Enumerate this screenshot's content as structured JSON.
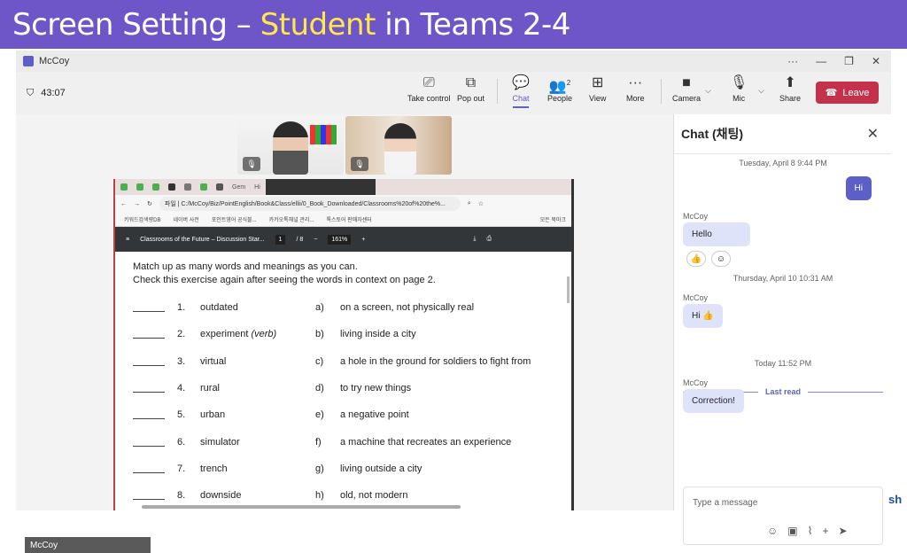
{
  "banner": {
    "prefix": "Screen Setting – ",
    "highlight": "Student",
    "suffix": " in Teams 2-4"
  },
  "window": {
    "title": "McCoy",
    "controls": [
      "···",
      "—",
      "❐",
      "✕"
    ]
  },
  "meeting": {
    "timer": "43:07"
  },
  "toolbar": {
    "take_control": "Take control",
    "pop_out": "Pop out",
    "chat": "Chat",
    "people": "People",
    "people_count": "2",
    "view": "View",
    "more": "More",
    "camera": "Camera",
    "mic": "Mic",
    "share": "Share",
    "leave": "Leave"
  },
  "participants": {
    "name": "McCoy"
  },
  "browser": {
    "tab_label": "Gem",
    "tab2_label": "Hi",
    "url": "C:/McCoy/Biz/PointEnglish/Book&Class/ellii/0_Book_Downloaded/Classrooms%20of%20the%...",
    "url_prefix": "파일",
    "bookmarks": [
      "키워드검색량DB",
      "네이버 사전",
      "포인트영어 공식블...",
      "카카오톡채널 관리...",
      "톡스토어 판매자센터",
      "모든 북마크"
    ]
  },
  "pdf": {
    "title": "Classrooms of the Future – Discussion Star...",
    "page": "1",
    "total_pages": "/ 8",
    "zoom": "161%",
    "intro1": "Match up as many words and meanings as you can.",
    "intro2": "Check this exercise again after seeing the words in context on page 2.",
    "rows": [
      {
        "num": "1.",
        "word": "outdated",
        "note": "",
        "letter": "a)",
        "meaning": "on a screen, not physically real"
      },
      {
        "num": "2.",
        "word": "experiment ",
        "note": "(verb)",
        "letter": "b)",
        "meaning": "living inside a city"
      },
      {
        "num": "3.",
        "word": "virtual",
        "note": "",
        "letter": "c)",
        "meaning": "a hole in the ground for soldiers to fight from"
      },
      {
        "num": "4.",
        "word": "rural",
        "note": "",
        "letter": "d)",
        "meaning": "to try new things"
      },
      {
        "num": "5.",
        "word": "urban",
        "note": "",
        "letter": "e)",
        "meaning": "a negative point"
      },
      {
        "num": "6.",
        "word": "simulator",
        "note": "",
        "letter": "f)",
        "meaning": "a machine that recreates an experience"
      },
      {
        "num": "7.",
        "word": "trench",
        "note": "",
        "letter": "g)",
        "meaning": "living outside a city"
      },
      {
        "num": "8.",
        "word": "downside",
        "note": "",
        "letter": "h)",
        "meaning": "old, not modern"
      }
    ]
  },
  "chat": {
    "title": "Chat (채팅)",
    "ts1": "Tuesday, April 8 9:44 PM",
    "me1": "Hi",
    "sender": "McCoy",
    "msg1": "Hello",
    "reaction": "👍",
    "ts2": "Thursday, April 10 10:31 AM",
    "msg2": "Hi 👍",
    "last_read": "Last read",
    "ts3": "Today 11:52 PM",
    "msg3": "Correction!",
    "placeholder": "Type a message"
  },
  "footer": {
    "brand": "sh"
  },
  "colors": {
    "banner": "#6e55c8",
    "highlight": "#ffe94a",
    "accent": "#5b5fc7",
    "leave": "#c4314b"
  }
}
